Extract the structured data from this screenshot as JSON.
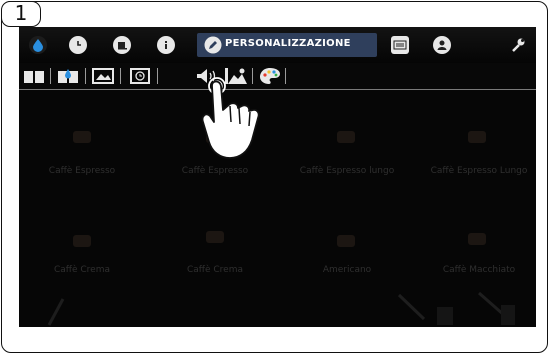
{
  "step_number": "1",
  "top_bar": {
    "icons": [
      "water-drop-icon",
      "clock-icon",
      "cup-icon",
      "info-icon"
    ],
    "active_tab_label": "PERSONALIZZAZIONE",
    "right_icons": [
      "keyboard-icon",
      "user-icon",
      "wrench-icon"
    ]
  },
  "sub_toolbar": {
    "icons": [
      "book-icon",
      "book-water-icon",
      "screen-image-icon",
      "screen-clock-icon",
      "speaker-icon",
      "landscape-icon",
      "palette-icon"
    ]
  },
  "drinks": [
    {
      "label": "Caffè Espresso"
    },
    {
      "label": "Caffè Espresso"
    },
    {
      "label": "Caffè Espresso lungo"
    },
    {
      "label": "Caffè Espresso Lungo"
    },
    {
      "label": "Caffè Crema"
    },
    {
      "label": "Caffè Crema"
    },
    {
      "label": "Americano"
    },
    {
      "label": "Caffè Macchiato"
    }
  ],
  "colors": {
    "active_tab": "#2f3f5c",
    "accent_blue": "#2a8fe0"
  }
}
